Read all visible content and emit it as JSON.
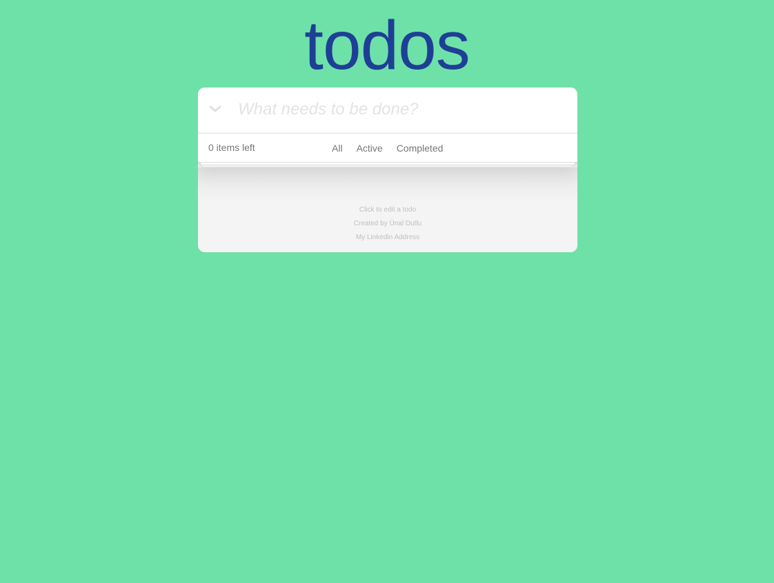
{
  "header": {
    "title": "todos",
    "new_todo_placeholder": "What needs to be done?",
    "toggle_all_icon": "chevron-down-icon"
  },
  "footer": {
    "items_left": "0 items left",
    "filters": [
      {
        "label": "All"
      },
      {
        "label": "Active"
      },
      {
        "label": "Completed"
      }
    ]
  },
  "info": {
    "hint": "Click to edit a todo",
    "credit": "Created by Ünal Dutlu",
    "link": "My Linkedin Address"
  },
  "colors": {
    "background": "#6ee1a8",
    "title": "#1e3f95",
    "card": "#ffffff",
    "text_muted": "#777777"
  }
}
